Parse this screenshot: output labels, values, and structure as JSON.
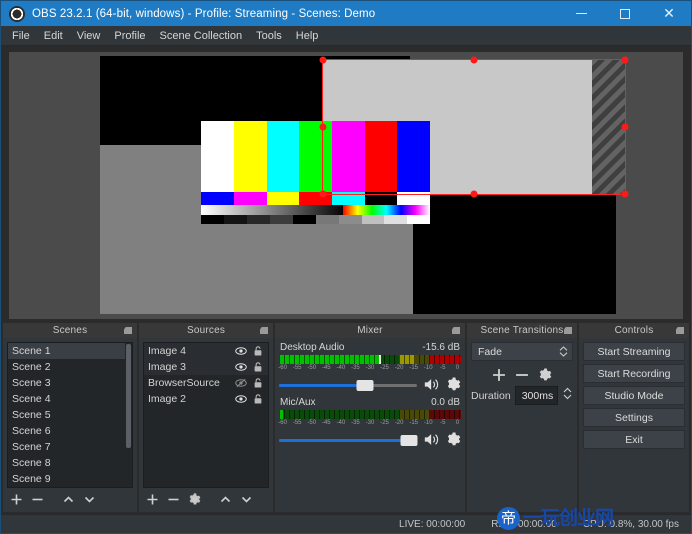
{
  "window": {
    "title": "OBS 23.2.1 (64-bit, windows) - Profile: Streaming - Scenes: Demo",
    "logo_icon": "obs-logo-icon",
    "minimize_icon": "minimize-icon",
    "maximize_icon": "maximize-icon",
    "close_icon": "close-icon",
    "close_glyph": "✕",
    "titlebar_color": "#1e7bc4"
  },
  "menubar": {
    "items": [
      {
        "label": "File"
      },
      {
        "label": "Edit"
      },
      {
        "label": "View"
      },
      {
        "label": "Profile"
      },
      {
        "label": "Scene Collection"
      },
      {
        "label": "Tools"
      },
      {
        "label": "Help"
      }
    ]
  },
  "preview": {
    "selection_color": "#ff1a1a",
    "canvas_background": "#4b4b4b"
  },
  "scenes": {
    "title": "Scenes",
    "items": [
      {
        "label": "Scene 1"
      },
      {
        "label": "Scene 2"
      },
      {
        "label": "Scene 3"
      },
      {
        "label": "Scene 4"
      },
      {
        "label": "Scene 5"
      },
      {
        "label": "Scene 6"
      },
      {
        "label": "Scene 7"
      },
      {
        "label": "Scene 8"
      },
      {
        "label": "Scene 9"
      }
    ],
    "tools": {
      "add": "add-scene-button",
      "remove": "remove-scene-button",
      "up": "move-scene-up-button",
      "down": "move-scene-down-button"
    }
  },
  "sources": {
    "title": "Sources",
    "items": [
      {
        "label": "Image 4",
        "visible": true,
        "locked": false
      },
      {
        "label": "Image 3",
        "visible": true,
        "locked": false
      },
      {
        "label": "BrowserSource",
        "visible": false,
        "locked": false
      },
      {
        "label": "Image 2",
        "visible": true,
        "locked": false
      }
    ],
    "tools": {
      "add": "add-source-button",
      "remove": "remove-source-button",
      "properties": "source-properties-button",
      "up": "move-source-up-button",
      "down": "move-source-down-button"
    }
  },
  "mixer": {
    "title": "Mixer",
    "scale_ticks": [
      "-60",
      "-55",
      "-50",
      "-45",
      "-40",
      "-35",
      "-30",
      "-25",
      "-20",
      "-15",
      "-10",
      "-5",
      "0"
    ],
    "channels": [
      {
        "name": "Desktop Audio",
        "level": "-15.6 dB",
        "meter_percent": 74,
        "volume_percent": 62,
        "muted": false
      },
      {
        "name": "Mic/Aux",
        "level": "0.0 dB",
        "meter_percent": 2,
        "volume_percent": 92,
        "muted": false
      }
    ]
  },
  "transitions": {
    "title": "Scene Transitions",
    "selected": "Fade",
    "duration_label": "Duration",
    "duration_value": "300ms",
    "tools": {
      "add": "add-transition-button",
      "remove": "remove-transition-button",
      "properties": "transition-properties-button"
    }
  },
  "controls": {
    "title": "Controls",
    "buttons": [
      {
        "label": "Start Streaming"
      },
      {
        "label": "Start Recording"
      },
      {
        "label": "Studio Mode"
      },
      {
        "label": "Settings"
      },
      {
        "label": "Exit"
      }
    ]
  },
  "statusbar": {
    "live": "LIVE: 00:00:00",
    "rec": "REC: 00:00:00",
    "cpu": "CPU: 0.8%, 30.00 fps"
  },
  "watermark": {
    "logo_char": "帝",
    "text": "一玩创业网",
    "color": "#1748a8"
  }
}
